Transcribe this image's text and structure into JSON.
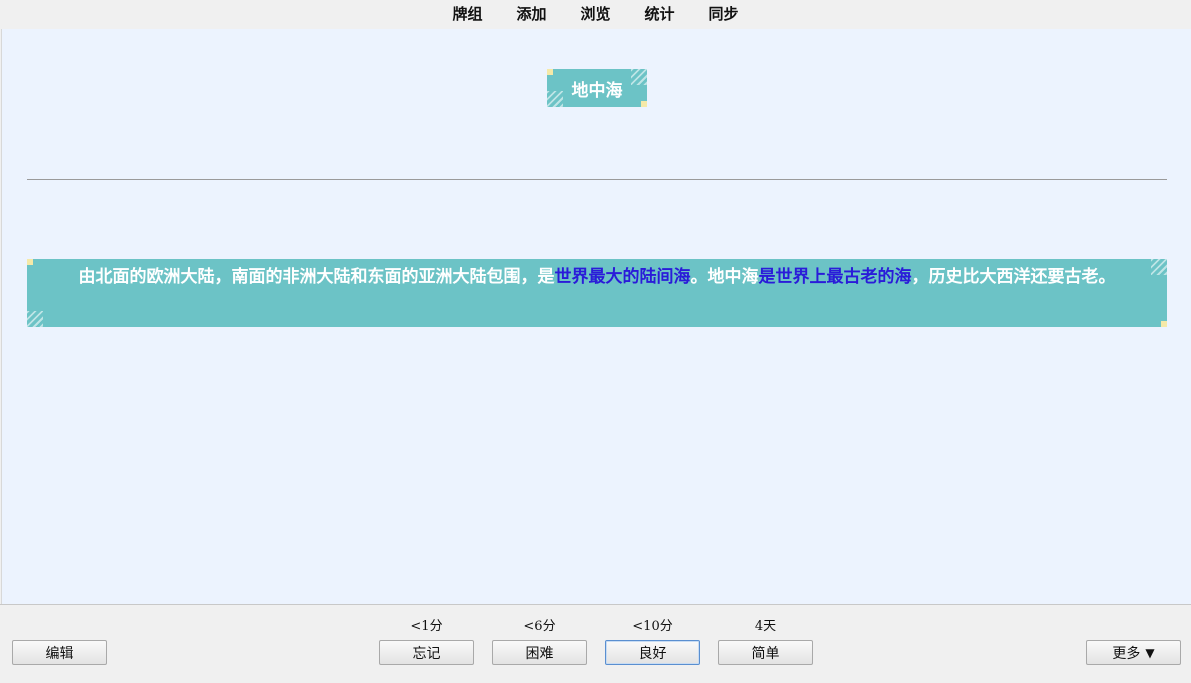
{
  "menu": {
    "items": [
      {
        "label": "牌组"
      },
      {
        "label": "添加"
      },
      {
        "label": "浏览"
      },
      {
        "label": "统计"
      },
      {
        "label": "同步"
      }
    ]
  },
  "card": {
    "title": "地中海",
    "answer": {
      "part1": "由北面的欧洲大陆，南面的非洲大陆和东面的亚洲大陆包围，是",
      "hl1": "世界最大的陆间海",
      "part2": "。地中海",
      "hl2": "是世界上最古老的海",
      "part3": "，历史比大西洋还要古老。"
    },
    "colors": {
      "box": "#6cc3c6",
      "highlight": "#2a1bd9",
      "background": "#ecf3fe",
      "corner": "#f5e9a8"
    }
  },
  "bottom": {
    "edit_label": "编辑",
    "more_label": "更多",
    "more_icon": "triangle-down-icon",
    "answers": [
      {
        "interval": "<1分",
        "label": "忘记"
      },
      {
        "interval": "<6分",
        "label": "困难"
      },
      {
        "interval": "<10分",
        "label": "良好"
      },
      {
        "interval": "4天",
        "label": "简单"
      }
    ]
  }
}
